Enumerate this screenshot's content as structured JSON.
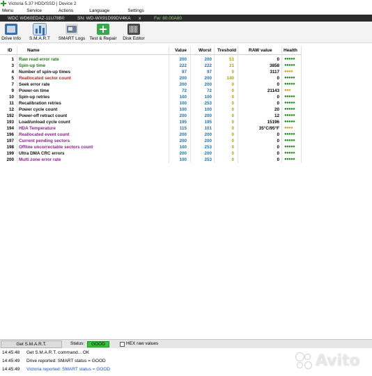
{
  "window": {
    "title": "Victoria 5.37 HDD/SSD | Device 2"
  },
  "menu": {
    "items": [
      "Menu",
      "Service",
      "Actions",
      "Language",
      "Settings"
    ]
  },
  "drive": {
    "model": "WDC WD60EDAZ-11U78B0",
    "serial": "SN: WD-WX91D99DV4KA",
    "close": "x",
    "firmware": "Fw: 80.00A80"
  },
  "toolbar": {
    "drive_info": "Drive Info",
    "smart": "S.M.A.R.T",
    "smart_logs": "SMART Logs",
    "test_repair": "Test & Repair",
    "disk_editor": "Disk Editor"
  },
  "table": {
    "headers": {
      "id": "ID",
      "name": "Name",
      "value": "Value",
      "worst": "Worst",
      "threshold": "Treshold",
      "raw": "RAW value",
      "health": "Health"
    },
    "rows": [
      {
        "id": "1",
        "name": "Raw read error rate",
        "value": "200",
        "worst": "200",
        "thr": "51",
        "raw": "0",
        "health": "●●●●●",
        "name_color": "green",
        "health_color": "good"
      },
      {
        "id": "3",
        "name": "Spin-up time",
        "value": "222",
        "worst": "222",
        "thr": "21",
        "raw": "3858",
        "health": "●●●●●",
        "name_color": "green",
        "health_color": "good"
      },
      {
        "id": "4",
        "name": "Number of spin-up times",
        "value": "97",
        "worst": "97",
        "thr": "0",
        "raw": "3117",
        "health": "●●●●",
        "name_color": "black",
        "health_color": "warn"
      },
      {
        "id": "5",
        "name": "Reallocated sector count",
        "value": "200",
        "worst": "200",
        "thr": "140",
        "raw": "0",
        "health": "●●●●●",
        "name_color": "red",
        "health_color": "good"
      },
      {
        "id": "7",
        "name": "Seek error rate",
        "value": "200",
        "worst": "200",
        "thr": "0",
        "raw": "0",
        "health": "●●●●●",
        "name_color": "black",
        "health_color": "good"
      },
      {
        "id": "9",
        "name": "Power-on time",
        "value": "72",
        "worst": "72",
        "thr": "0",
        "raw": "21143",
        "health": "●●●",
        "name_color": "black",
        "health_color": "warn"
      },
      {
        "id": "10",
        "name": "Spin-up retries",
        "value": "100",
        "worst": "100",
        "thr": "0",
        "raw": "0",
        "health": "●●●●●",
        "name_color": "black",
        "health_color": "good"
      },
      {
        "id": "11",
        "name": "Recalibration retries",
        "value": "100",
        "worst": "253",
        "thr": "0",
        "raw": "0",
        "health": "●●●●●",
        "name_color": "black",
        "health_color": "good"
      },
      {
        "id": "12",
        "name": "Power cycle count",
        "value": "100",
        "worst": "100",
        "thr": "0",
        "raw": "20",
        "health": "●●●●●",
        "name_color": "black",
        "health_color": "good"
      },
      {
        "id": "192",
        "name": "Power-off retract count",
        "value": "200",
        "worst": "200",
        "thr": "0",
        "raw": "12",
        "health": "●●●●●",
        "name_color": "black",
        "health_color": "good"
      },
      {
        "id": "193",
        "name": "Load/unload cycle count",
        "value": "195",
        "worst": "195",
        "thr": "0",
        "raw": "15196",
        "health": "●●●●●",
        "name_color": "black",
        "health_color": "good"
      },
      {
        "id": "194",
        "name": "HDA Temperature",
        "value": "115",
        "worst": "101",
        "thr": "0",
        "raw": "35°C/95°F",
        "health": "●●●●",
        "name_color": "purple",
        "health_color": "warn"
      },
      {
        "id": "196",
        "name": "Reallocated event count",
        "value": "200",
        "worst": "200",
        "thr": "0",
        "raw": "0",
        "health": "●●●●●",
        "name_color": "purple",
        "health_color": "good"
      },
      {
        "id": "197",
        "name": "Current pending sectors",
        "value": "200",
        "worst": "200",
        "thr": "0",
        "raw": "0",
        "health": "●●●●●",
        "name_color": "purple",
        "health_color": "good"
      },
      {
        "id": "198",
        "name": "Offline uncorrectable sectors count",
        "value": "100",
        "worst": "253",
        "thr": "0",
        "raw": "0",
        "health": "●●●●●",
        "name_color": "purple",
        "health_color": "good"
      },
      {
        "id": "199",
        "name": "Ultra DMA CRC errors",
        "value": "200",
        "worst": "200",
        "thr": "0",
        "raw": "0",
        "health": "●●●●●",
        "name_color": "black",
        "health_color": "good"
      },
      {
        "id": "200",
        "name": "Multi zone error rate",
        "value": "100",
        "worst": "253",
        "thr": "0",
        "raw": "0",
        "health": "●●●●●",
        "name_color": "purple",
        "health_color": "good"
      }
    ]
  },
  "statusbar": {
    "get_smart": "Get S.M.A.R.T.",
    "status_label": "Status:",
    "status_value": "GOOD",
    "hex_label": "HEX raw values"
  },
  "log": [
    {
      "time": "14:45:48",
      "msg": "Get S.M.A.R.T. command... OK",
      "style": "normal"
    },
    {
      "time": "14:45:49",
      "msg": "Drive reported: SMART status = GOOD",
      "style": "normal"
    },
    {
      "time": "14:45:49",
      "msg": "Victoria reported: SMART status = GOOD",
      "style": "blue"
    }
  ],
  "watermark": {
    "text": "Avito"
  },
  "colors": {
    "status_good": "#38c438",
    "drive_bar": "#2b2b2b",
    "name_green": "#1f7a14",
    "name_red": "#c41d1d",
    "name_purple": "#8b1e8b",
    "value_blue": "#1e6fb0",
    "threshold_olive": "#a2a40a",
    "health_good": "#1c8a16",
    "health_warn": "#d4a017"
  },
  "icons": {
    "app": "green-cross-icon",
    "drive_info": "drive-info-icon",
    "smart": "bar-chart-icon",
    "smart_logs": "logs-icon",
    "test_repair": "repair-cross-icon",
    "disk_editor": "disk-editor-icon"
  }
}
